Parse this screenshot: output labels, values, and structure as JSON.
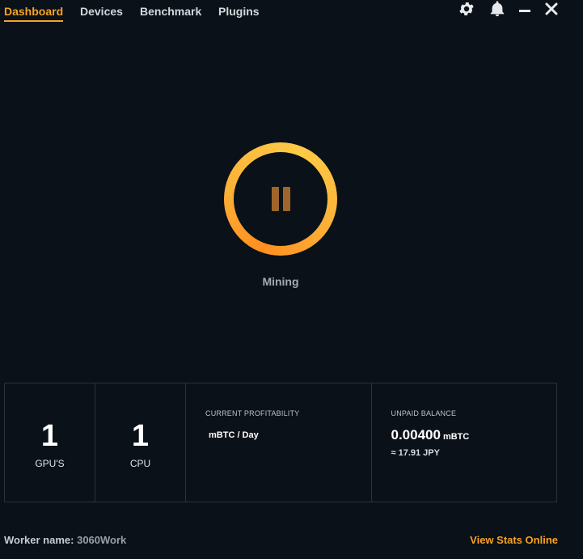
{
  "nav": {
    "tabs": [
      {
        "label": "Dashboard",
        "active": true
      },
      {
        "label": "Devices",
        "active": false
      },
      {
        "label": "Benchmark",
        "active": false
      },
      {
        "label": "Plugins",
        "active": false
      }
    ]
  },
  "window_controls": [
    "gear-icon",
    "bell-icon",
    "minimize-icon",
    "close-icon"
  ],
  "mining": {
    "state_label": "Mining",
    "button_icon": "pause-icon"
  },
  "stats": {
    "gpus": {
      "value": "1",
      "label": "GPU'S"
    },
    "cpu": {
      "value": "1",
      "label": "CPU"
    },
    "profitability": {
      "caption": "CURRENT PROFITABILITY",
      "unit": "mBTC / Day"
    },
    "balance": {
      "caption": "UNPAID BALANCE",
      "value": "0.00400",
      "unit": "mBTC",
      "fiat": "≈ 17.91 JPY"
    }
  },
  "footer": {
    "worker_label": "Worker name:",
    "worker_value": "3060Work",
    "stats_link": "View Stats Online"
  },
  "colors": {
    "background": "#0a1118",
    "accent": "#f7a324",
    "ring_gradient": [
      "#ff8f1f",
      "#ffcb45"
    ],
    "border": "#2a323b"
  }
}
